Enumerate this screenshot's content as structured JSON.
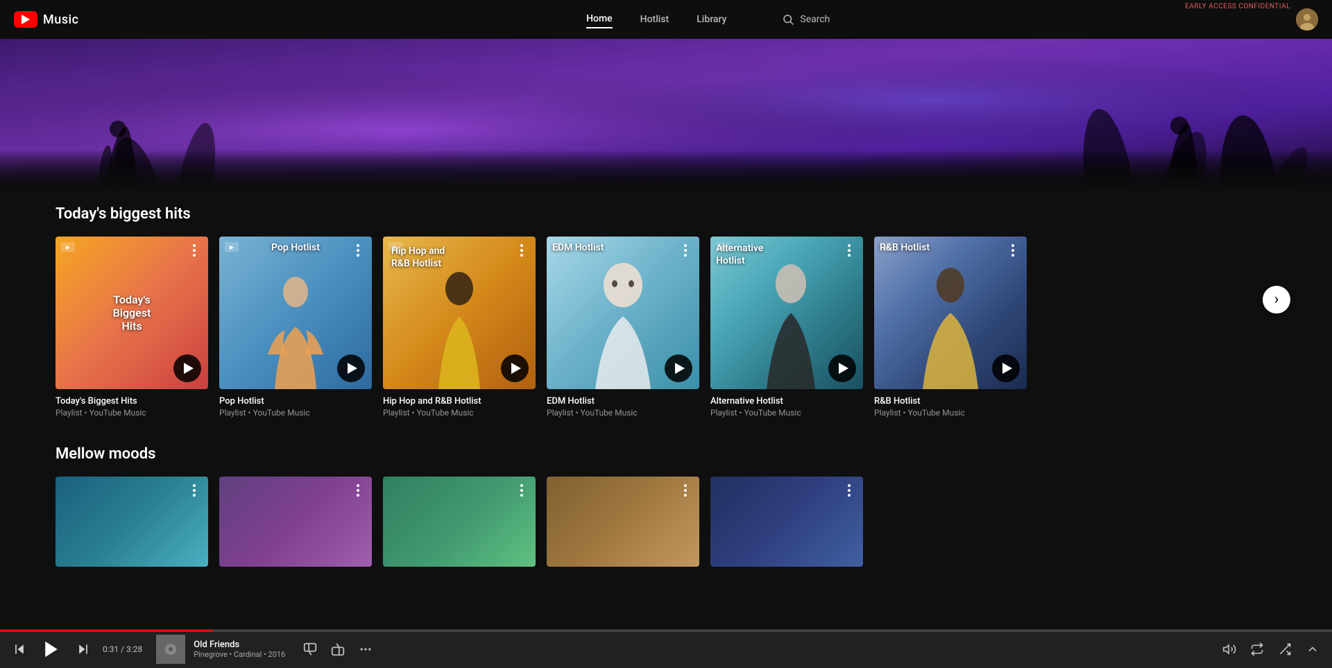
{
  "app": {
    "title": "Music",
    "early_access_label": "EARLY ACCESS CONFIDENTIAL"
  },
  "navbar": {
    "logo_label": "Music",
    "links": [
      {
        "id": "home",
        "label": "Home",
        "active": true
      },
      {
        "id": "hotlist",
        "label": "Hotlist",
        "active": false
      },
      {
        "id": "library",
        "label": "Library",
        "active": false
      }
    ],
    "search_label": "Search"
  },
  "sections": [
    {
      "id": "biggest-hits",
      "title": "Today's biggest hits",
      "cards": [
        {
          "id": "todays-biggest-hits",
          "name": "Today's Biggest Hits",
          "subtitle": "Playlist • YouTube Music",
          "bg_class": "bg-orange",
          "label": "Today's Biggest\nHits"
        },
        {
          "id": "pop-hotlist",
          "name": "Pop Hotlist",
          "subtitle": "Playlist • YouTube Music",
          "bg_class": "bg-pop",
          "label": "Pop Hotlist"
        },
        {
          "id": "hiphop-rnb-hotlist",
          "name": "Hip Hop and R&B Hotlist",
          "subtitle": "Playlist • YouTube Music",
          "bg_class": "bg-hiphop",
          "label": "Hip Hop and\nR&B Hotlist"
        },
        {
          "id": "edm-hotlist",
          "name": "EDM Hotlist",
          "subtitle": "Playlist • YouTube Music",
          "bg_class": "bg-edm",
          "label": "EDM Hotlist"
        },
        {
          "id": "alternative-hotlist",
          "name": "Alternative Hotlist",
          "subtitle": "Playlist • YouTube Music",
          "bg_class": "bg-alt",
          "label": "Alternative\nHotlist"
        },
        {
          "id": "rnb-hotlist",
          "name": "R&B Hotlist",
          "subtitle": "Playlist • YouTube Music",
          "bg_class": "bg-rnb",
          "label": "R&B Hotlist"
        }
      ]
    },
    {
      "id": "mellow-moods",
      "title": "Mellow moods",
      "cards": [
        {
          "id": "mellow1",
          "bg_class": "bg-mellow1"
        },
        {
          "id": "mellow2",
          "bg_class": "bg-mellow2"
        },
        {
          "id": "mellow3",
          "bg_class": "bg-mellow3"
        },
        {
          "id": "mellow4",
          "bg_class": "bg-mellow4"
        },
        {
          "id": "mellow5",
          "bg_class": "bg-mellow5"
        }
      ]
    }
  ],
  "player": {
    "track_name": "Old Friends",
    "track_sub": "Pinegrove • Cardinal • 2016",
    "current_time": "0:31",
    "total_time": "3:28",
    "time_display": "0:31 / 3:28",
    "progress_percent": 16
  }
}
